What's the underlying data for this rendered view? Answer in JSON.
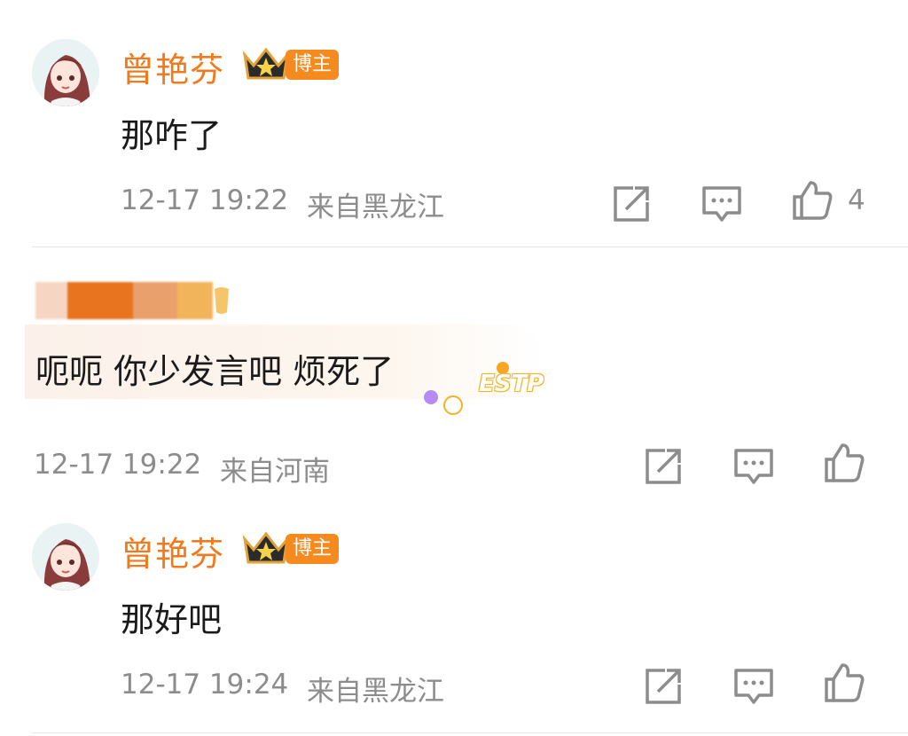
{
  "comments": [
    {
      "username": "曾艳芬",
      "badge": "博主",
      "text": "那咋了",
      "time": "12-17 19:22",
      "location": "来自黑龙江",
      "likes": "4"
    },
    {
      "username": "",
      "text": "呃呃 你少发言吧 烦死了",
      "sticker_label": "ESTP",
      "time": "12-17 19:22",
      "location": "来自河南"
    },
    {
      "username": "曾艳芬",
      "badge": "博主",
      "text": "那好吧",
      "time": "12-17 19:24",
      "location": "来自黑龙江"
    }
  ],
  "icons": {
    "share": "share-icon",
    "reply": "comment-icon",
    "like": "thumbs-up-icon"
  },
  "colors": {
    "username": "#f07b1e",
    "badge": "#f58a1f",
    "meta": "#8c8c8c"
  }
}
